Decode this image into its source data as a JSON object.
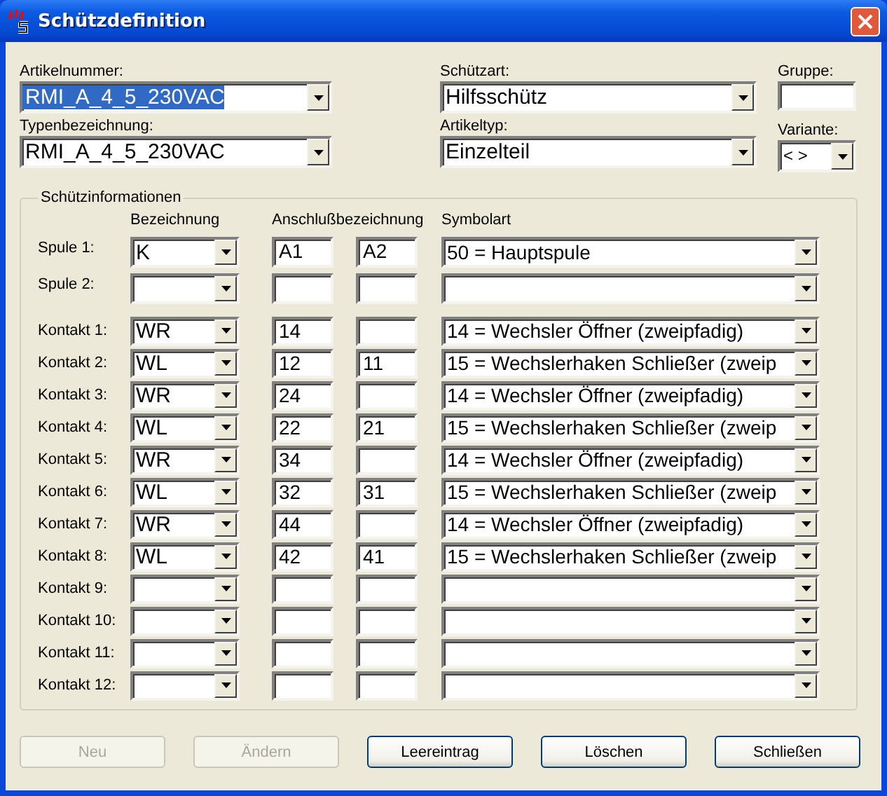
{
  "window": {
    "title": "Schützdefinition"
  },
  "fields": {
    "artikelnummer": {
      "label": "Artikelnummer:",
      "value": "RMI_A_4_5_230VAC",
      "selected": true
    },
    "typenbezeichnung": {
      "label": "Typenbezeichnung:",
      "value": "RMI_A_4_5_230VAC"
    },
    "schuetzart": {
      "label": "Schützart:",
      "value": "Hilfsschütz"
    },
    "artikeltyp": {
      "label": "Artikeltyp:",
      "value": "Einzelteil"
    },
    "gruppe": {
      "label": "Gruppe:"
    },
    "variante": {
      "label": "Variante:",
      "value": "< >"
    }
  },
  "group": {
    "title": "Schützinformationen",
    "columns": [
      "Bezeichnung",
      "Anschlußbezeichnung",
      "Symbolart"
    ]
  },
  "coils": [
    {
      "label": "Spule 1:",
      "bezeichnung": "K",
      "anschluss_1": "A1",
      "anschluss_2": "A2",
      "symbolart": "50 = Hauptspule"
    },
    {
      "label": "Spule 2:"
    }
  ],
  "contacts": [
    {
      "label": "Kontakt 1:",
      "bezeichnung": "WR",
      "anschluss_1": "14",
      "symbolart": "14 = Wechsler Öffner (zweipfadig)"
    },
    {
      "label": "Kontakt 2:",
      "bezeichnung": "WL",
      "anschluss_1": "12",
      "anschluss_2": "11",
      "symbolart": "15 = Wechslerhaken Schließer (zweip"
    },
    {
      "label": "Kontakt 3:",
      "bezeichnung": "WR",
      "anschluss_1": "24",
      "symbolart": "14 = Wechsler Öffner (zweipfadig)"
    },
    {
      "label": "Kontakt 4:",
      "bezeichnung": "WL",
      "anschluss_1": "22",
      "anschluss_2": "21",
      "symbolart": "15 = Wechslerhaken Schließer (zweip"
    },
    {
      "label": "Kontakt 5:",
      "bezeichnung": "WR",
      "anschluss_1": "34",
      "symbolart": "14 = Wechsler Öffner (zweipfadig)"
    },
    {
      "label": "Kontakt 6:",
      "bezeichnung": "WL",
      "anschluss_1": "32",
      "anschluss_2": "31",
      "symbolart": "15 = Wechslerhaken Schließer (zweip"
    },
    {
      "label": "Kontakt 7:",
      "bezeichnung": "WR",
      "anschluss_1": "44",
      "symbolart": "14 = Wechsler Öffner (zweipfadig)"
    },
    {
      "label": "Kontakt 8:",
      "bezeichnung": "WL",
      "anschluss_1": "42",
      "anschluss_2": "41",
      "symbolart": "15 = Wechslerhaken Schließer (zweip"
    },
    {
      "label": "Kontakt 9:"
    },
    {
      "label": "Kontakt 10:"
    },
    {
      "label": "Kontakt 11:"
    },
    {
      "label": "Kontakt 12:"
    }
  ],
  "buttons": [
    {
      "label": "Neu",
      "disabled": true
    },
    {
      "label": "Ändern",
      "disabled": true
    },
    {
      "label": "Leereintrag",
      "disabled": false
    },
    {
      "label": "Löschen",
      "disabled": false
    },
    {
      "label": "Schließen",
      "disabled": false
    }
  ]
}
